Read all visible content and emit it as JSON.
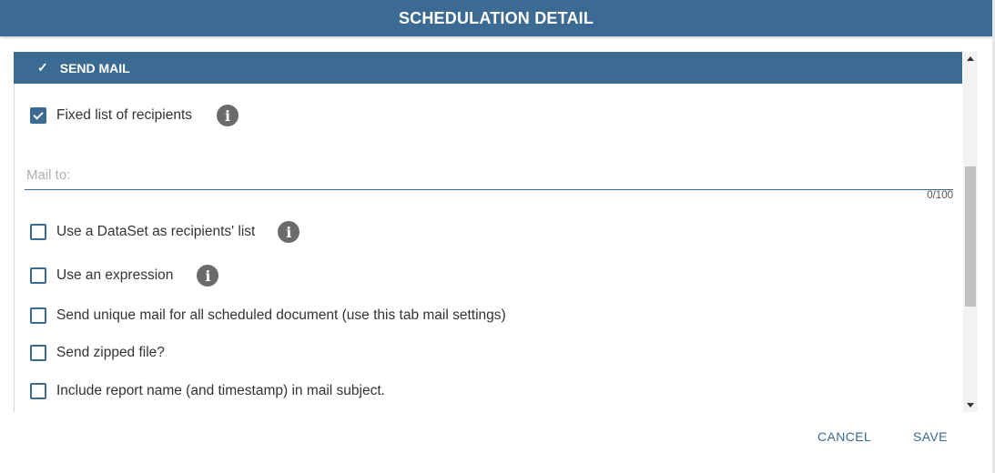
{
  "dialog": {
    "title": "SCHEDULATION DETAIL"
  },
  "section": {
    "title": "SEND MAIL",
    "check_glyph": "✓"
  },
  "options": {
    "fixed_list": {
      "label": "Fixed list of recipients",
      "checked": true,
      "info_icon": "info-icon"
    },
    "dataset": {
      "label": "Use a DataSet as recipients' list",
      "checked": false,
      "info_icon": "info-icon"
    },
    "expression": {
      "label": "Use an expression",
      "checked": false,
      "info_icon": "info-icon"
    },
    "unique_mail": {
      "label": "Send unique mail for all scheduled document (use this tab mail settings)",
      "checked": false
    },
    "zipped": {
      "label": "Send zipped file?",
      "checked": false
    },
    "include_name": {
      "label": "Include report name (and timestamp) in mail subject.",
      "checked": false
    }
  },
  "mail_to": {
    "placeholder": "Mail to:",
    "value": "",
    "counter": "0/100"
  },
  "buttons": {
    "cancel": "CANCEL",
    "save": "SAVE"
  },
  "colors": {
    "primary": "#3b6a92",
    "info_icon": "#6b6b6b"
  }
}
